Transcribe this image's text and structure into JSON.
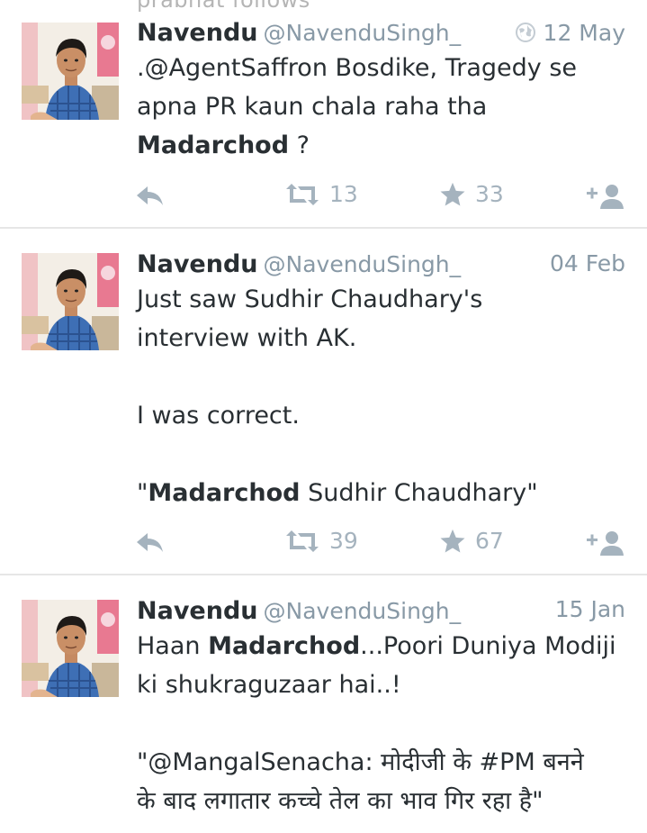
{
  "top_clipped_text": "prabhat follows",
  "tweets": [
    {
      "name": "Navendu",
      "handle": "@NavenduSingh_",
      "date": "12 May",
      "show_globe": true,
      "lines": [
        [
          {
            "t": ".@AgentSaffron Bosdike, Tragedy se"
          }
        ],
        [
          {
            "t": "apna PR kaun chala raha tha"
          }
        ],
        [
          {
            "t": "Madarchod",
            "b": true
          },
          {
            "t": " ?"
          }
        ]
      ],
      "retweets": "13",
      "favorites": "33"
    },
    {
      "name": "Navendu",
      "handle": "@NavenduSingh_",
      "date": "04 Feb",
      "show_globe": false,
      "lines": [
        [
          {
            "t": "Just saw Sudhir Chaudhary's"
          }
        ],
        [
          {
            "t": "interview with AK."
          }
        ],
        [],
        [
          {
            "t": "I was correct."
          }
        ],
        [],
        [
          {
            "t": "\""
          },
          {
            "t": "Madarchod",
            "b": true
          },
          {
            "t": " Sudhir Chaudhary\""
          }
        ]
      ],
      "retweets": "39",
      "favorites": "67"
    },
    {
      "name": "Navendu",
      "handle": "@NavenduSingh_",
      "date": "15 Jan",
      "show_globe": false,
      "lines": [
        [
          {
            "t": "Haan "
          },
          {
            "t": "Madarchod",
            "b": true
          },
          {
            "t": "...Poori Duniya Modiji"
          }
        ],
        [
          {
            "t": "ki shukraguzaar hai..!"
          }
        ],
        [],
        [
          {
            "t": "\"@MangalSenacha: मोदीजी के #PM बनने"
          }
        ],
        [
          {
            "t": "के बाद लगातार कच्चे तेल का भाव गिर रहा है\""
          }
        ]
      ],
      "retweets": "",
      "favorites": ""
    }
  ],
  "icons": {
    "reply": "reply-arrow-icon",
    "retweet": "retweet-icon",
    "favorite": "star-icon",
    "follow": "follow-user-icon",
    "globe": "globe-icon"
  },
  "colors": {
    "text": "#292f33",
    "muted": "#8899a6",
    "action": "#a5b3be",
    "divider": "#e6e6e6"
  }
}
